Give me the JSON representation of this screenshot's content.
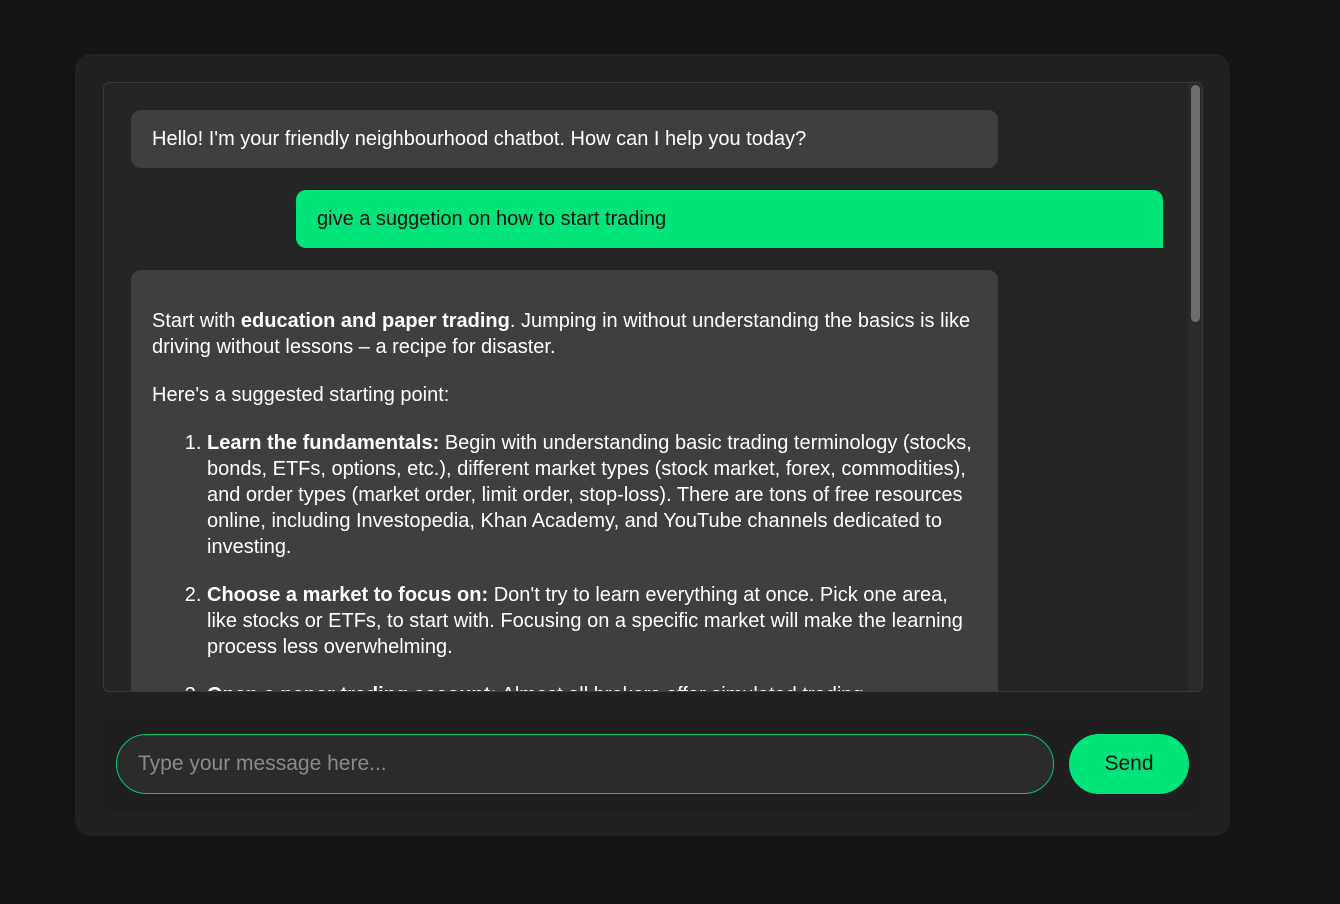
{
  "messages": {
    "greeting": "Hello! I'm your friendly neighbourhood chatbot. How can I help you today?",
    "user_prompt": "give a suggetion on how to start trading",
    "answer": {
      "intro_prefix": "Start with ",
      "intro_bold": "education and paper trading",
      "intro_suffix": ". Jumping in without understanding the basics is like driving without lessons – a recipe for disaster.",
      "lead": "Here's a suggested starting point:",
      "steps": [
        {
          "title": "Learn the fundamentals:",
          "text": " Begin with understanding basic trading terminology (stocks, bonds, ETFs, options, etc.), different market types (stock market, forex, commodities), and order types (market order, limit order, stop-loss). There are tons of free resources online, including Investopedia, Khan Academy, and YouTube channels dedicated to investing."
        },
        {
          "title": "Choose a market to focus on:",
          "text": " Don't try to learn everything at once. Pick one area, like stocks or ETFs, to start with. Focusing on a specific market will make the learning process less overwhelming."
        },
        {
          "title": "Open a paper trading account:",
          "text": " Almost all brokers offer simulated trading"
        }
      ]
    }
  },
  "input": {
    "placeholder": "Type your message here...",
    "value": ""
  },
  "send_button": {
    "label": "Send"
  },
  "colors": {
    "accent": "#00e47a",
    "bot_bubble": "#3f3f3f",
    "background": "#141414"
  }
}
